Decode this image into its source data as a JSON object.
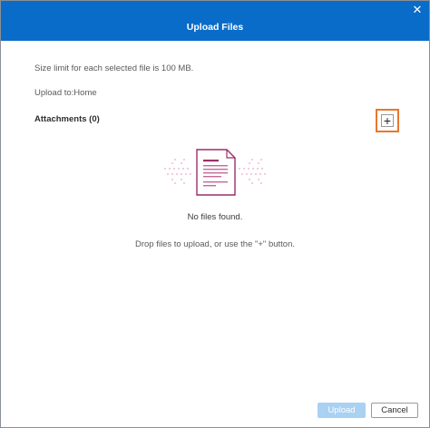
{
  "dialog": {
    "title": "Upload Files",
    "close_glyph": "✕",
    "size_limit_text": "Size limit for each selected file is 100 MB.",
    "upload_to_text": "Upload to:Home",
    "attachments_label": "Attachments (0)",
    "add_glyph": "+",
    "empty_message": "No files found.",
    "drop_message": "Drop files to upload, or use the \"+\" button.",
    "upload_label": "Upload",
    "cancel_label": "Cancel"
  },
  "icons": {
    "close": "close-icon",
    "add": "plus-icon",
    "empty_state": "document-icon"
  },
  "colors": {
    "header_bg": "#0a6cc9",
    "highlight": "#e8772e",
    "document_accent": "#9b2f6a",
    "upload_disabled": "#a9d1f2"
  }
}
